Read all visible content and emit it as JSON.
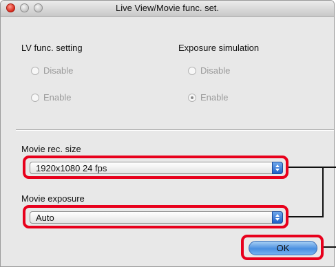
{
  "window": {
    "title": "Live View/Movie func. set."
  },
  "lv_func": {
    "heading": "LV func. setting",
    "options": [
      "Disable",
      "Enable"
    ]
  },
  "exposure_simulation": {
    "heading": "Exposure simulation",
    "options": [
      "Disable",
      "Enable"
    ],
    "selected": "Enable"
  },
  "movie_rec_size": {
    "label": "Movie rec. size",
    "value": "1920x1080 24 fps"
  },
  "movie_exposure": {
    "label": "Movie exposure",
    "value": "Auto"
  },
  "ok_label": "OK",
  "colors": {
    "highlight": "#e8001c",
    "accent": "#3d7fe0"
  },
  "icons": {
    "close": "close-icon",
    "minimize": "minimize-icon",
    "zoom": "zoom-icon",
    "popup_arrows": "chevron-updown-icon"
  }
}
